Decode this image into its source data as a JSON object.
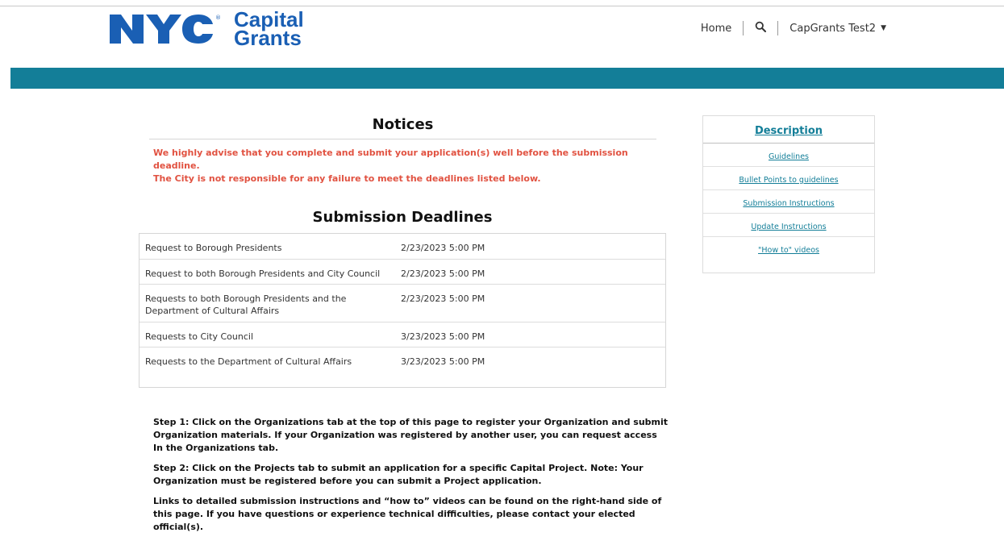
{
  "header": {
    "logo_mark": "NYC",
    "logo_text_line1": "Capital",
    "logo_text_line2": "Grants",
    "nav": {
      "home": "Home",
      "search_icon": "search-icon",
      "user": "CapGrants Test2"
    }
  },
  "colors": {
    "brand_blue": "#1a5fb4",
    "teal": "#137e98",
    "warning_red": "#e15241"
  },
  "notices": {
    "title": "Notices",
    "warning_line1": "We highly advise that you complete and submit your application(s) well before the submission deadline.",
    "warning_line2": "The City is not responsible for any failure to meet the deadlines listed below."
  },
  "deadlines": {
    "title": "Submission Deadlines",
    "rows": [
      {
        "label": "Request to Borough Presidents",
        "date": "2/23/2023 5:00 PM"
      },
      {
        "label": "Request to both Borough Presidents and City Council",
        "date": "2/23/2023 5:00 PM"
      },
      {
        "label": "Requests to both Borough Presidents and the Department of Cultural Affairs",
        "date": "2/23/2023 5:00 PM"
      },
      {
        "label": "Requests to City Council",
        "date": "3/23/2023 5:00 PM"
      },
      {
        "label": "Requests to the Department of Cultural Affairs",
        "date": "3/23/2023 5:00 PM"
      }
    ]
  },
  "steps": {
    "step1": "Step 1: Click on the Organizations tab at the top of this page to register your Organization and submit Organization materials. If your Organization was registered by another user, you can request access In the Organizations tab.",
    "step2": "Step 2: Click on the Projects tab to submit an application for a specific Capital Project. Note: Your Organization must be registered before you can submit a Project application.",
    "links_note": "Links to detailed submission instructions and “how to” videos can be found on the right-hand side of this page. If you have questions or experience technical difficulties, please contact your elected official(s)."
  },
  "sidebar": {
    "title": "Description",
    "links": [
      "Guidelines",
      "Bullet Points to guidelines",
      "Submission Instructions",
      "Update Instructions",
      "\"How to\" videos"
    ]
  }
}
